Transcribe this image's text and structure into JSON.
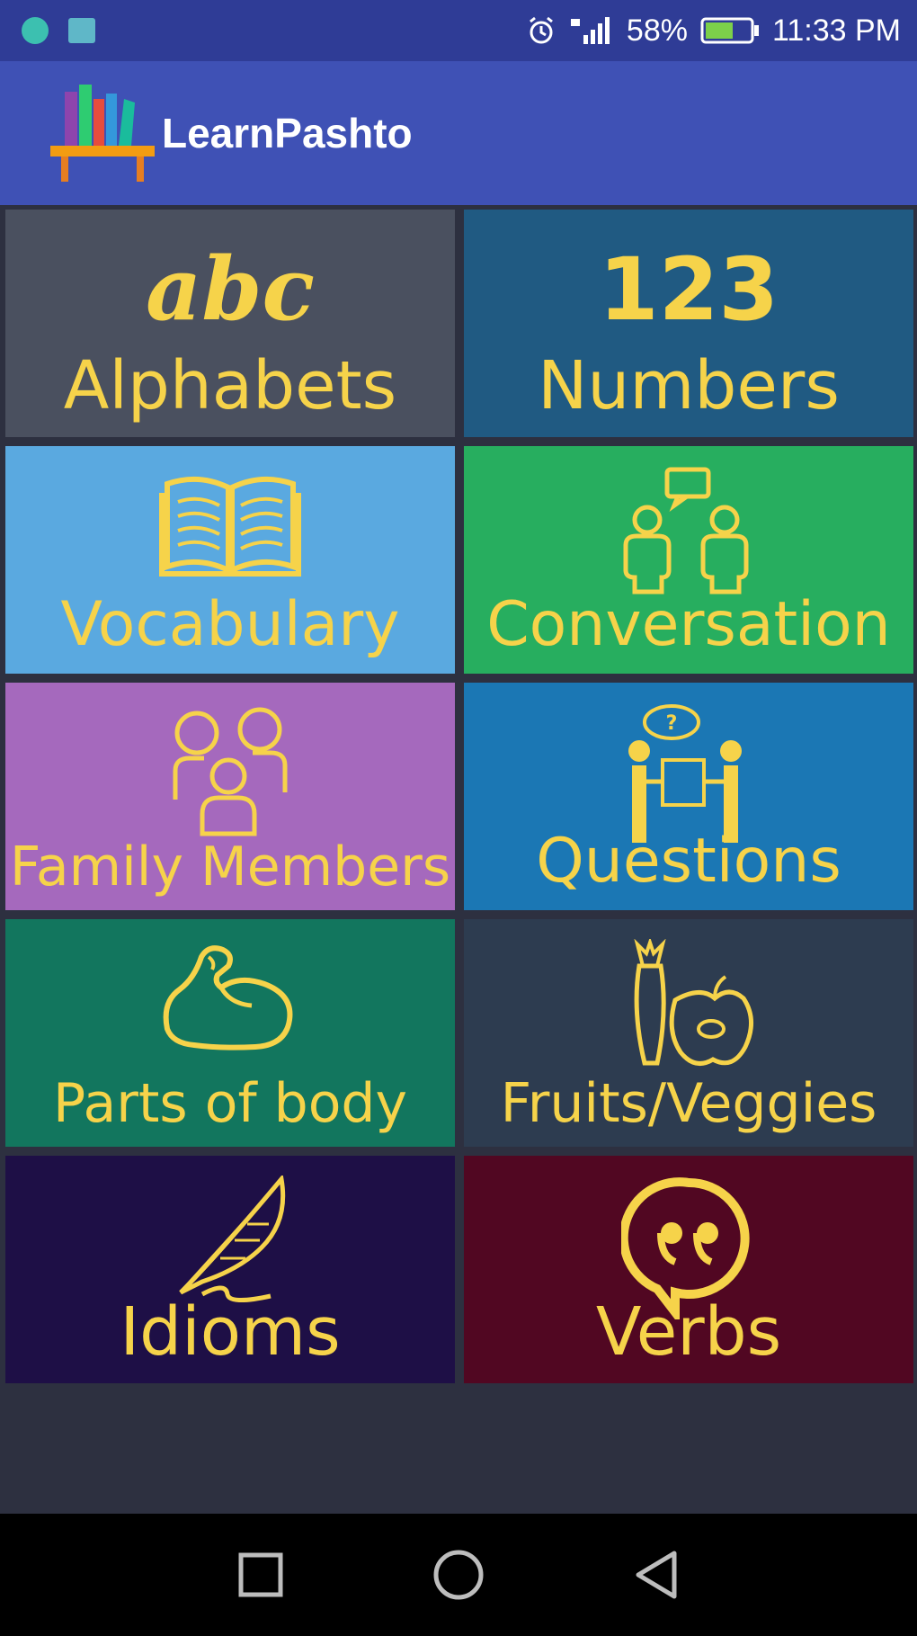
{
  "status_bar": {
    "battery": "58%",
    "time": "11:33 PM"
  },
  "app_bar": {
    "title": "LearnPashto"
  },
  "tiles": [
    {
      "label": "Alphabets",
      "icon": "abc-icon",
      "color": "#4a505f",
      "glyph": "abc"
    },
    {
      "label": "Numbers",
      "icon": "numbers-123-icon",
      "color": "#205a82",
      "glyph": "123"
    },
    {
      "label": "Vocabulary",
      "icon": "open-book-icon",
      "color": "#5aa9e0"
    },
    {
      "label": "Conversation",
      "icon": "people-chat-icon",
      "color": "#27ae5f"
    },
    {
      "label": "Family Members",
      "icon": "family-icon",
      "color": "#a569bd"
    },
    {
      "label": "Questions",
      "icon": "question-people-icon",
      "color": "#1b77b4"
    },
    {
      "label": "Parts of body",
      "icon": "muscle-arm-icon",
      "color": "#12765e"
    },
    {
      "label": "Fruits/Veggies",
      "icon": "fruit-veggie-icon",
      "color": "#2d3c50"
    },
    {
      "label": "Idioms",
      "icon": "quill-pen-icon",
      "color": "#1e0f46"
    },
    {
      "label": "Verbs",
      "icon": "quote-bubble-icon",
      "color": "#510722"
    }
  ],
  "colors": {
    "accent_text": "#f6d34a",
    "app_bar": "#3f51b5",
    "status_bar": "#2f3c96",
    "background": "#2d3040"
  },
  "nav_bar": {
    "icons": [
      "recent-apps-icon",
      "home-icon",
      "back-icon"
    ]
  }
}
